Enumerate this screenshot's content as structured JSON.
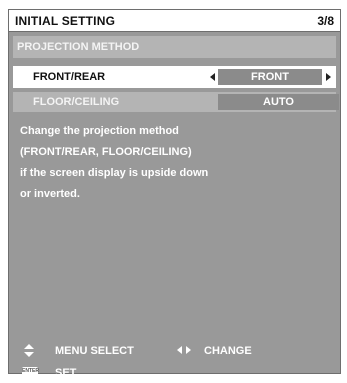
{
  "header": {
    "title": "INITIAL SETTING",
    "page": "3/8"
  },
  "section": {
    "label": "PROJECTION METHOD"
  },
  "settings": [
    {
      "label": "FRONT/REAR",
      "value": "FRONT"
    },
    {
      "label": "FLOOR/CEILING",
      "value": "AUTO"
    }
  ],
  "description": [
    "Change the projection method",
    "(FRONT/REAR, FLOOR/CEILING)",
    "if the screen display is upside down",
    "or inverted."
  ],
  "footer": {
    "menu_select": "MENU SELECT",
    "change": "CHANGE",
    "enter_icon": "ENTER",
    "set": "SET"
  }
}
